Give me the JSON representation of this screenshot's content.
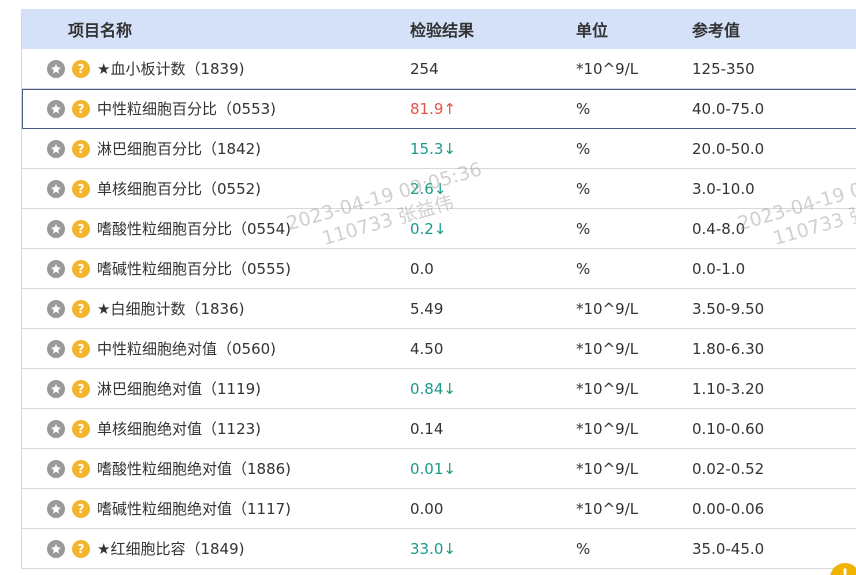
{
  "header": {
    "name": "项目名称",
    "result": "检验结果",
    "unit": "单位",
    "reference": "参考值"
  },
  "rows": [
    {
      "name": "★血小板计数（1839)",
      "result": "254",
      "flag": "",
      "unit": "*10^9/L",
      "reference": "125-350"
    },
    {
      "name": "中性粒细胞百分比（0553)",
      "result": "81.9",
      "flag": "↑",
      "unit": "%",
      "reference": "40.0-75.0"
    },
    {
      "name": "淋巴细胞百分比（1842)",
      "result": "15.3",
      "flag": "↓",
      "unit": "%",
      "reference": "20.0-50.0"
    },
    {
      "name": "单核细胞百分比（0552)",
      "result": "2.6",
      "flag": "↓",
      "unit": "%",
      "reference": "3.0-10.0"
    },
    {
      "name": "嗜酸性粒细胞百分比（0554)",
      "result": "0.2",
      "flag": "↓",
      "unit": "%",
      "reference": "0.4-8.0"
    },
    {
      "name": "嗜碱性粒细胞百分比（0555)",
      "result": "0.0",
      "flag": "",
      "unit": "%",
      "reference": "0.0-1.0"
    },
    {
      "name": "★白细胞计数（1836)",
      "result": "5.49",
      "flag": "",
      "unit": "*10^9/L",
      "reference": "3.50-9.50"
    },
    {
      "name": "中性粒细胞绝对值（0560)",
      "result": "4.50",
      "flag": "",
      "unit": "*10^9/L",
      "reference": "1.80-6.30"
    },
    {
      "name": "淋巴细胞绝对值（1119)",
      "result": "0.84",
      "flag": "↓",
      "unit": "*10^9/L",
      "reference": "1.10-3.20"
    },
    {
      "name": "单核细胞绝对值（1123)",
      "result": "0.14",
      "flag": "",
      "unit": "*10^9/L",
      "reference": "0.10-0.60"
    },
    {
      "name": "嗜酸性粒细胞绝对值（1886)",
      "result": "0.01",
      "flag": "↓",
      "unit": "*10^9/L",
      "reference": "0.02-0.52"
    },
    {
      "name": "嗜碱性粒细胞绝对值（1117)",
      "result": "0.00",
      "flag": "",
      "unit": "*10^9/L",
      "reference": "0.00-0.06"
    },
    {
      "name": "★红细胞比容（1849)",
      "result": "33.0",
      "flag": "↓",
      "unit": "%",
      "reference": "35.0-45.0"
    }
  ],
  "selected_row": 1,
  "watermarks": [
    {
      "line1": "2023-04-19 09:05:36",
      "line2": "110733 张益伟"
    },
    {
      "line1": "2023-04-19 0",
      "line2": "110733 张"
    }
  ],
  "icons": {
    "favorite": "star-icon",
    "help": "question-icon",
    "help_glyph": "?",
    "corner": "notification-icon",
    "corner_glyph": "!"
  },
  "colors": {
    "header_bg": "#d5e1f8",
    "high": "#e8524a",
    "low": "#1a9a8a",
    "help_badge": "#f3b52f",
    "star_badge": "#9a9a9a"
  }
}
